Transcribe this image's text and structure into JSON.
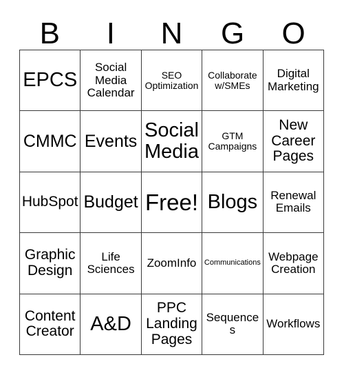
{
  "card": {
    "title": "BINGO",
    "header_letters": [
      "B",
      "I",
      "N",
      "G",
      "O"
    ],
    "grid_size": "5x5",
    "free_space_label": "Free!",
    "colors": {
      "background": "#ffffff",
      "border": "#3a3a3a",
      "text": "#000000"
    },
    "rows": [
      [
        {
          "text": "EPCS",
          "size": "xl"
        },
        {
          "text": "Social Media Calendar",
          "size": "sm"
        },
        {
          "text": "SEO Optimization",
          "size": "xs"
        },
        {
          "text": "Collaborate w/SMEs",
          "size": "xs"
        },
        {
          "text": "Digital Marketing",
          "size": "sm"
        }
      ],
      [
        {
          "text": "CMMC",
          "size": "lg"
        },
        {
          "text": "Events",
          "size": "lg"
        },
        {
          "text": "Social Media",
          "size": "xl"
        },
        {
          "text": "GTM Campaigns",
          "size": "xs"
        },
        {
          "text": "New Career Pages",
          "size": "md"
        }
      ],
      [
        {
          "text": "HubSpot",
          "size": "md"
        },
        {
          "text": "Budget",
          "size": "lg"
        },
        {
          "text": "Free!",
          "size": "xxl"
        },
        {
          "text": "Blogs",
          "size": "xl"
        },
        {
          "text": "Renewal Emails",
          "size": "sm"
        }
      ],
      [
        {
          "text": "Graphic Design",
          "size": "md"
        },
        {
          "text": "Life Sciences",
          "size": "sm"
        },
        {
          "text": "ZoomInfo",
          "size": "sm"
        },
        {
          "text": "Communications",
          "size": "xxs"
        },
        {
          "text": "Webpage Creation",
          "size": "sm"
        }
      ],
      [
        {
          "text": "Content Creator",
          "size": "md"
        },
        {
          "text": "A&D",
          "size": "xl"
        },
        {
          "text": "PPC Landing Pages",
          "size": "md"
        },
        {
          "text": "Sequences",
          "size": "sm"
        },
        {
          "text": "Workflows",
          "size": "sm"
        }
      ]
    ]
  }
}
